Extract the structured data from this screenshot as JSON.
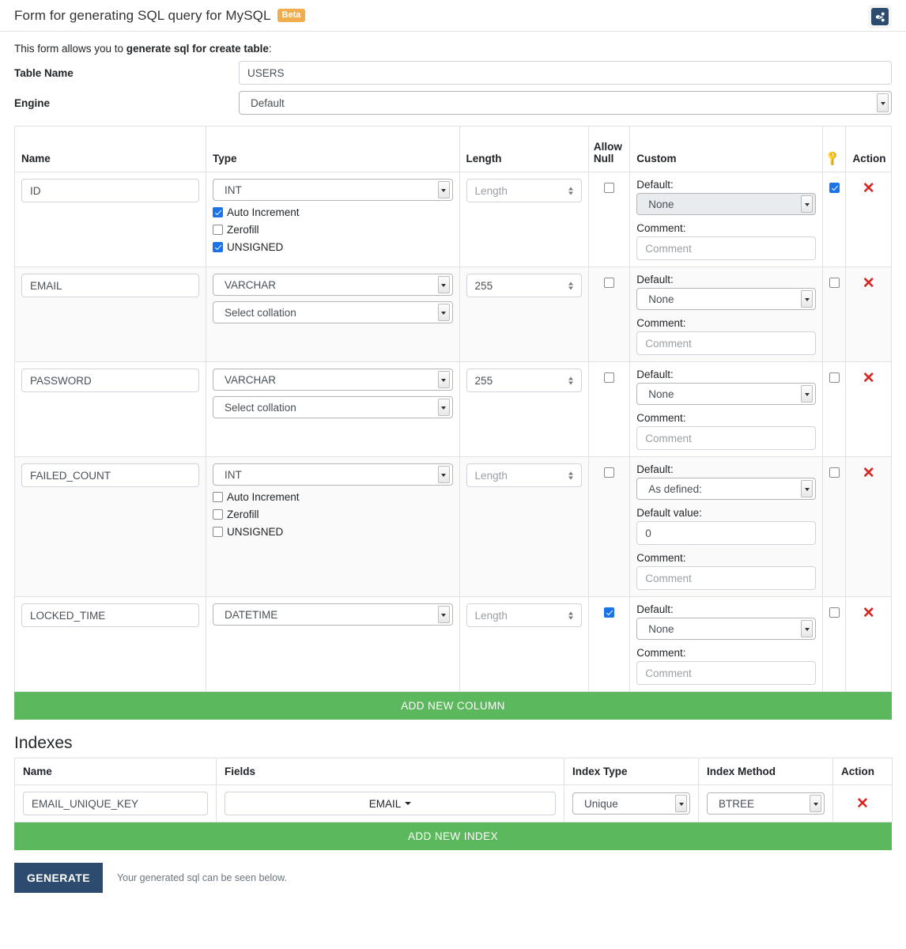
{
  "header": {
    "title": "Form for generating SQL query for MySQL",
    "badge": "Beta",
    "share_icon": "share-icon"
  },
  "intro": {
    "prefix": "This form allows you to ",
    "bold": "generate sql for create table",
    "suffix": ":"
  },
  "form": {
    "table_name_label": "Table Name",
    "table_name_value": "USERS",
    "engine_label": "Engine",
    "engine_value": "Default"
  },
  "columns_table": {
    "headers": {
      "name": "Name",
      "type": "Type",
      "length": "Length",
      "allow_null": "Allow\nNull",
      "allow_null_l1": "Allow",
      "allow_null_l2": "Null",
      "custom": "Custom",
      "key": "key-icon",
      "action": "Action"
    },
    "labels": {
      "auto_increment": "Auto Increment",
      "zerofill": "Zerofill",
      "unsigned": "UNSIGNED",
      "default": "Default:",
      "default_value": "Default value:",
      "comment": "Comment:",
      "length_placeholder": "Length",
      "comment_placeholder": "Comment",
      "collation_placeholder": "Select collation"
    },
    "rows": [
      {
        "name": "ID",
        "type": "INT",
        "has_int_opts": true,
        "auto_increment": true,
        "zerofill": false,
        "unsigned": true,
        "has_collation": false,
        "collation": "",
        "length": "",
        "length_placeholder": "Length",
        "allow_null": false,
        "default": "None",
        "default_disabled": true,
        "default_value": null,
        "comment": "",
        "comment_placeholder": "Comment",
        "primary_key": true,
        "striped": false,
        "action": "✕"
      },
      {
        "name": "EMAIL",
        "type": "VARCHAR",
        "has_int_opts": false,
        "auto_increment": false,
        "zerofill": false,
        "unsigned": false,
        "has_collation": true,
        "collation": "Select collation",
        "length": "255",
        "length_placeholder": "Length",
        "allow_null": false,
        "default": "None",
        "default_disabled": false,
        "default_value": null,
        "comment": "",
        "comment_placeholder": "Comment",
        "primary_key": false,
        "striped": true,
        "action": "✕"
      },
      {
        "name": "PASSWORD",
        "type": "VARCHAR",
        "has_int_opts": false,
        "auto_increment": false,
        "zerofill": false,
        "unsigned": false,
        "has_collation": true,
        "collation": "Select collation",
        "length": "255",
        "length_placeholder": "Length",
        "allow_null": false,
        "default": "None",
        "default_disabled": false,
        "default_value": null,
        "comment": "",
        "comment_placeholder": "Comment",
        "primary_key": false,
        "striped": false,
        "action": "✕"
      },
      {
        "name": "FAILED_COUNT",
        "type": "INT",
        "has_int_opts": true,
        "auto_increment": false,
        "zerofill": false,
        "unsigned": false,
        "has_collation": false,
        "collation": "",
        "length": "",
        "length_placeholder": "Length",
        "allow_null": false,
        "default": "As defined:",
        "default_disabled": false,
        "default_value": "0",
        "comment": "",
        "comment_placeholder": "Comment",
        "primary_key": false,
        "striped": true,
        "action": "✕"
      },
      {
        "name": "LOCKED_TIME",
        "type": "DATETIME",
        "has_int_opts": false,
        "auto_increment": false,
        "zerofill": false,
        "unsigned": false,
        "has_collation": false,
        "collation": "",
        "length": "",
        "length_placeholder": "Length",
        "allow_null": true,
        "default": "None",
        "default_disabled": false,
        "default_value": null,
        "comment": "",
        "comment_placeholder": "Comment",
        "primary_key": false,
        "striped": false,
        "action": "✕"
      }
    ],
    "add_button": "ADD NEW COLUMN"
  },
  "indexes": {
    "title": "Indexes",
    "headers": {
      "name": "Name",
      "fields": "Fields",
      "index_type": "Index Type",
      "index_method": "Index Method",
      "action": "Action"
    },
    "rows": [
      {
        "name": "EMAIL_UNIQUE_KEY",
        "fields": "EMAIL",
        "index_type": "Unique",
        "index_method": "BTREE",
        "action": "✕"
      }
    ],
    "add_button": "ADD NEW INDEX"
  },
  "footer": {
    "generate_label": "GENERATE",
    "note": "Your generated sql can be seen below."
  },
  "colors": {
    "green": "#5cb85c",
    "navy": "#2c4b6e",
    "orange": "#f0ad4e",
    "red": "#d9241f",
    "checkbox_blue": "#1a73e8"
  }
}
